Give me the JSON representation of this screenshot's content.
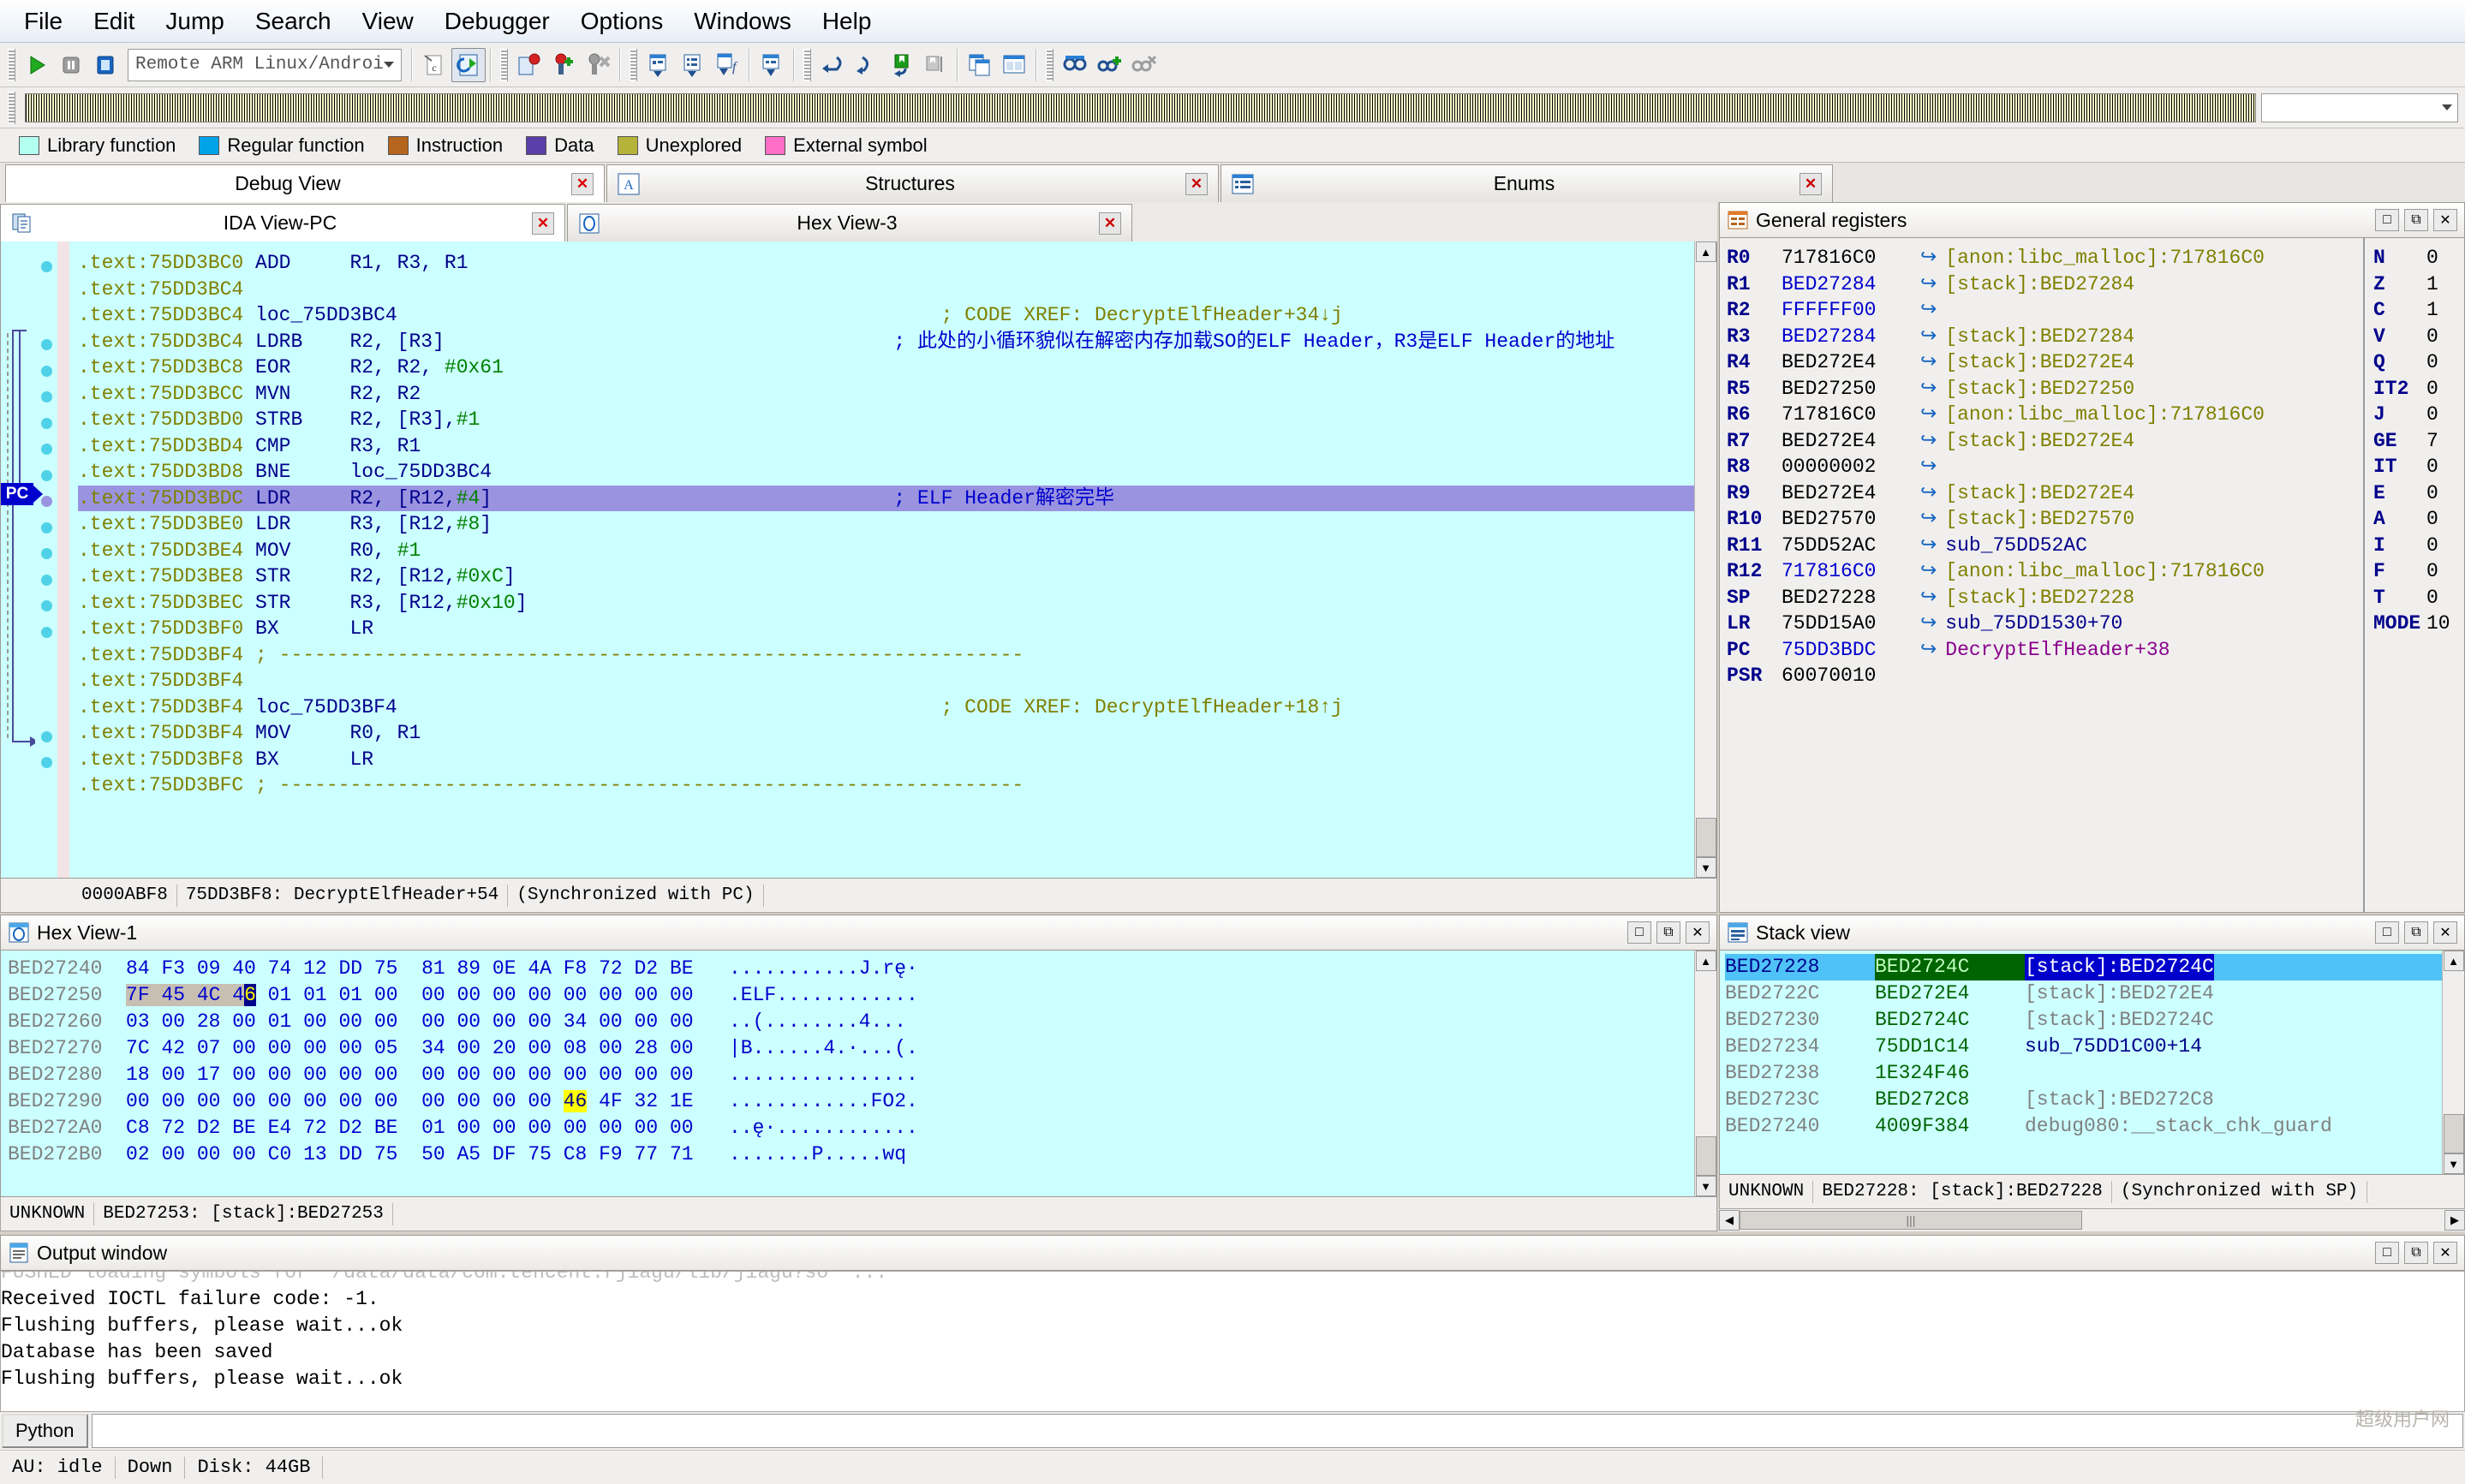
{
  "menu": {
    "items": [
      "File",
      "Edit",
      "Jump",
      "Search",
      "View",
      "Debugger",
      "Options",
      "Windows",
      "Help"
    ]
  },
  "toolbar": {
    "debugger_select": "Remote ARM Linux/Android debugger",
    "run_icon": "run-icon",
    "pause_icon": "pause-icon",
    "stop_icon": "stop-icon"
  },
  "legend": {
    "items": [
      {
        "label": "Library function",
        "color": "#b3fff0"
      },
      {
        "label": "Regular function",
        "color": "#00a2e8"
      },
      {
        "label": "Instruction",
        "color": "#b5651d"
      },
      {
        "label": "Data",
        "color": "#5b3fa8"
      },
      {
        "label": "Unexplored",
        "color": "#b5b33a"
      },
      {
        "label": "External symbol",
        "color": "#ff6ec7"
      }
    ]
  },
  "top_tabs": [
    {
      "label": "Debug View",
      "active": true,
      "closable": true
    },
    {
      "label": "Structures",
      "active": false,
      "closable": true,
      "icon": "letter-a-icon"
    },
    {
      "label": "Enums",
      "active": false,
      "closable": true,
      "icon": "list-icon"
    }
  ],
  "sub_tabs": [
    {
      "label": "IDA View-PC",
      "active": true,
      "closable": true,
      "icon": "document-pair-icon"
    },
    {
      "label": "Hex View-3",
      "active": false,
      "closable": true,
      "icon": "hex-icon"
    }
  ],
  "disassembly": {
    "lines": [
      {
        "seg": ".text:75DD3BC0",
        "mnem": "ADD",
        "ops": "R1, R3, R1",
        "comment": "",
        "dot": "blue"
      },
      {
        "seg": ".text:75DD3BC4",
        "mnem": "",
        "ops": "",
        "comment": "",
        "dot": "none"
      },
      {
        "seg": ".text:75DD3BC4",
        "label": "loc_75DD3BC4",
        "comment": "; CODE XREF: DecryptElfHeader+34↓j",
        "dot": "none"
      },
      {
        "seg": ".text:75DD3BC4",
        "mnem": "LDRB",
        "ops": "R2, [R3]",
        "comment": "; 此处的小循环貌似在解密内存加载SO的ELF Header，R3是ELF Header的地址",
        "dot": "blue",
        "arrow": true
      },
      {
        "seg": ".text:75DD3BC8",
        "mnem": "EOR",
        "ops": "R2, R2, #0x61",
        "comment": "",
        "dot": "blue"
      },
      {
        "seg": ".text:75DD3BCC",
        "mnem": "MVN",
        "ops": "R2, R2",
        "comment": "",
        "dot": "blue"
      },
      {
        "seg": ".text:75DD3BD0",
        "mnem": "STRB",
        "ops": "R2, [R3],#1",
        "comment": "",
        "dot": "blue"
      },
      {
        "seg": ".text:75DD3BD4",
        "mnem": "CMP",
        "ops": "R3, R1",
        "comment": "",
        "dot": "blue"
      },
      {
        "seg": ".text:75DD3BD8",
        "mnem": "BNE",
        "ops": "loc_75DD3BC4",
        "comment": "",
        "dot": "blue",
        "jumpback": true
      },
      {
        "seg": ".text:75DD3BDC",
        "mnem": "LDR",
        "ops": "R2, [R12,#4]",
        "comment": "; ELF Header解密完毕",
        "dot": "pc",
        "current": true
      },
      {
        "seg": ".text:75DD3BE0",
        "mnem": "LDR",
        "ops": "R3, [R12,#8]",
        "comment": "",
        "dot": "blue"
      },
      {
        "seg": ".text:75DD3BE4",
        "mnem": "MOV",
        "ops": "R0, #1",
        "comment": "",
        "dot": "blue"
      },
      {
        "seg": ".text:75DD3BE8",
        "mnem": "STR",
        "ops": "R2, [R12,#0xC]",
        "comment": "",
        "dot": "blue"
      },
      {
        "seg": ".text:75DD3BEC",
        "mnem": "STR",
        "ops": "R3, [R12,#0x10]",
        "comment": "",
        "dot": "blue"
      },
      {
        "seg": ".text:75DD3BF0",
        "mnem": "BX",
        "ops": "LR",
        "comment": "",
        "dot": "blue"
      },
      {
        "seg": ".text:75DD3BF4",
        "divider": "; ---------------------------------------------------------------",
        "dot": "none"
      },
      {
        "seg": ".text:75DD3BF4",
        "mnem": "",
        "ops": "",
        "comment": "",
        "dot": "none"
      },
      {
        "seg": ".text:75DD3BF4",
        "label": "loc_75DD3BF4",
        "comment": "; CODE XREF: DecryptElfHeader+18↑j",
        "dot": "none"
      },
      {
        "seg": ".text:75DD3BF4",
        "mnem": "MOV",
        "ops": "R0, R1",
        "comment": "",
        "dot": "blue",
        "arrow": true
      },
      {
        "seg": ".text:75DD3BF8",
        "mnem": "BX",
        "ops": "LR",
        "comment": "",
        "dot": "blue"
      },
      {
        "seg": ".text:75DD3BFC",
        "divider": "; ---------------------------------------------------------------",
        "dot": "none"
      }
    ],
    "status": [
      "0000ABF8",
      "75DD3BF8: DecryptElfHeader+54",
      "(Synchronized with PC)"
    ]
  },
  "registers": {
    "title": "General registers",
    "rows": [
      {
        "name": "R0",
        "value": "717816C0",
        "desc": "[anon:libc_malloc]:717816C0",
        "desc_style": "olive",
        "arrow": true,
        "val_style": "dark"
      },
      {
        "name": "R1",
        "value": "BED27284",
        "desc": "[stack]:BED27284",
        "desc_style": "olive",
        "arrow": true,
        "val_style": "blue"
      },
      {
        "name": "R2",
        "value": "FFFFFF00",
        "desc": "",
        "desc_style": "olive",
        "arrow": true,
        "val_style": "blue"
      },
      {
        "name": "R3",
        "value": "BED27284",
        "desc": "[stack]:BED27284",
        "desc_style": "olive",
        "arrow": true,
        "val_style": "blue"
      },
      {
        "name": "R4",
        "value": "BED272E4",
        "desc": "[stack]:BED272E4",
        "desc_style": "olive",
        "arrow": true,
        "val_style": "dark"
      },
      {
        "name": "R5",
        "value": "BED27250",
        "desc": "[stack]:BED27250",
        "desc_style": "olive",
        "arrow": true,
        "val_style": "dark"
      },
      {
        "name": "R6",
        "value": "717816C0",
        "desc": "[anon:libc_malloc]:717816C0",
        "desc_style": "olive",
        "arrow": true,
        "val_style": "dark"
      },
      {
        "name": "R7",
        "value": "BED272E4",
        "desc": "[stack]:BED272E4",
        "desc_style": "olive",
        "arrow": true,
        "val_style": "dark"
      },
      {
        "name": "R8",
        "value": "00000002",
        "desc": "",
        "desc_style": "olive",
        "arrow": true,
        "val_style": "dark"
      },
      {
        "name": "R9",
        "value": "BED272E4",
        "desc": "[stack]:BED272E4",
        "desc_style": "olive",
        "arrow": true,
        "val_style": "dark"
      },
      {
        "name": "R10",
        "value": "BED27570",
        "desc": "[stack]:BED27570",
        "desc_style": "olive",
        "arrow": true,
        "val_style": "dark"
      },
      {
        "name": "R11",
        "value": "75DD52AC",
        "desc": "sub_75DD52AC",
        "desc_style": "navy",
        "arrow": true,
        "val_style": "dark"
      },
      {
        "name": "R12",
        "value": "717816C0",
        "desc": "[anon:libc_malloc]:717816C0",
        "desc_style": "olive",
        "arrow": true,
        "val_style": "blue"
      },
      {
        "name": "SP",
        "value": "BED27228",
        "desc": "[stack]:BED27228",
        "desc_style": "olive",
        "arrow": true,
        "val_style": "dark"
      },
      {
        "name": "LR",
        "value": "75DD15A0",
        "desc": "sub_75DD1530+70",
        "desc_style": "navy",
        "arrow": true,
        "val_style": "dark"
      },
      {
        "name": "PC",
        "value": "75DD3BDC",
        "desc": "DecryptElfHeader+38",
        "desc_style": "purple",
        "arrow": true,
        "val_style": "blue"
      },
      {
        "name": "PSR",
        "value": "60070010",
        "desc": "",
        "desc_style": "olive",
        "arrow": false,
        "val_style": "dark"
      }
    ],
    "flags": [
      {
        "name": "N",
        "value": "0"
      },
      {
        "name": "Z",
        "value": "1"
      },
      {
        "name": "C",
        "value": "1"
      },
      {
        "name": "V",
        "value": "0"
      },
      {
        "name": "Q",
        "value": "0"
      },
      {
        "name": "IT2",
        "value": "0"
      },
      {
        "name": "J",
        "value": "0"
      },
      {
        "name": "GE",
        "value": "7"
      },
      {
        "name": "IT",
        "value": "0"
      },
      {
        "name": "E",
        "value": "0"
      },
      {
        "name": "A",
        "value": "0"
      },
      {
        "name": "I",
        "value": "0"
      },
      {
        "name": "F",
        "value": "0"
      },
      {
        "name": "T",
        "value": "0"
      },
      {
        "name": "MODE",
        "value": "10"
      }
    ]
  },
  "hexview": {
    "title": "Hex View-1",
    "rows": [
      {
        "addr": "BED27240",
        "b1": "84 F3 09 40 74 12 DD 75",
        "b2": "81 89 0E 4A F8 72 D2 BE",
        "ascii": "...........J.rę·"
      },
      {
        "addr": "BED27250",
        "b1": "7F 45 4C 46 01 01 01 00",
        "b2": "00 00 00 00 00 00 00 00",
        "ascii": ".ELF............",
        "sel": "7F 45 4C 4",
        "cursor": "6"
      },
      {
        "addr": "BED27260",
        "b1": "03 00 28 00 01 00 00 00",
        "b2": "00 00 00 00 34 00 00 00",
        "ascii": "..(........4..."
      },
      {
        "addr": "BED27270",
        "b1": "7C 42 07 00 00 00 00 05",
        "b2": "34 00 20 00 08 00 28 00",
        "ascii": "|B......4.·...(."
      },
      {
        "addr": "BED27280",
        "b1": "18 00 17 00 00 00 00 00",
        "b2": "00 00 00 00 00 00 00 00",
        "ascii": "................"
      },
      {
        "addr": "BED27290",
        "b1": "00 00 00 00 00 00 00 00",
        "b2": "00 00 00 00 46 4F 32 1E",
        "ascii": "............FO2.",
        "hl_byte_index": 12
      },
      {
        "addr": "BED272A0",
        "b1": "C8 72 D2 BE E4 72 D2 BE",
        "b2": "01 00 00 00 00 00 00 00",
        "ascii": "..ę·............"
      },
      {
        "addr": "BED272B0",
        "b1": "02 00 00 00 C0 13 DD 75",
        "b2": "50 A5 DF 75 C8 F9 77 71",
        "ascii": ".......P.....wq"
      }
    ],
    "status": [
      "UNKNOWN",
      "BED27253: [stack]:BED27253"
    ]
  },
  "stackview": {
    "title": "Stack view",
    "rows": [
      {
        "addr": "BED27228",
        "value": "BED2724C",
        "desc": "[stack]:BED2724C",
        "selected": true
      },
      {
        "addr": "BED2722C",
        "value": "BED272E4",
        "desc": "[stack]:BED272E4",
        "selected": false
      },
      {
        "addr": "BED27230",
        "value": "BED2724C",
        "desc": "[stack]:BED2724C",
        "selected": false
      },
      {
        "addr": "BED27234",
        "value": "75DD1C14",
        "desc": "sub_75DD1C00+14",
        "selected": false,
        "desc_style": "navy"
      },
      {
        "addr": "BED27238",
        "value": "1E324F46",
        "desc": "",
        "selected": false
      },
      {
        "addr": "BED2723C",
        "value": "BED272C8",
        "desc": "[stack]:BED272C8",
        "selected": false
      },
      {
        "addr": "BED27240",
        "value": "4009F384",
        "desc": "debug080:__stack_chk_guard",
        "selected": false
      }
    ],
    "status": [
      "UNKNOWN",
      "BED27228: [stack]:BED27228",
      "(Synchronized with SP)"
    ]
  },
  "output": {
    "title": "Output window",
    "lines": [
      "FUSHED loading symbols for '/data/data/com.tencent.rjiagu/lib/jiagu?so' ...",
      "Received IOCTL failure code: -1.",
      "Flushing buffers, please wait...ok",
      "Database has been saved",
      "Flushing buffers, please wait...ok"
    ],
    "python_label": "Python",
    "python_value": ""
  },
  "statusbar": {
    "cells": [
      "AU: idle",
      "Down",
      "Disk: 44GB"
    ]
  },
  "watermark": "超级用户网"
}
